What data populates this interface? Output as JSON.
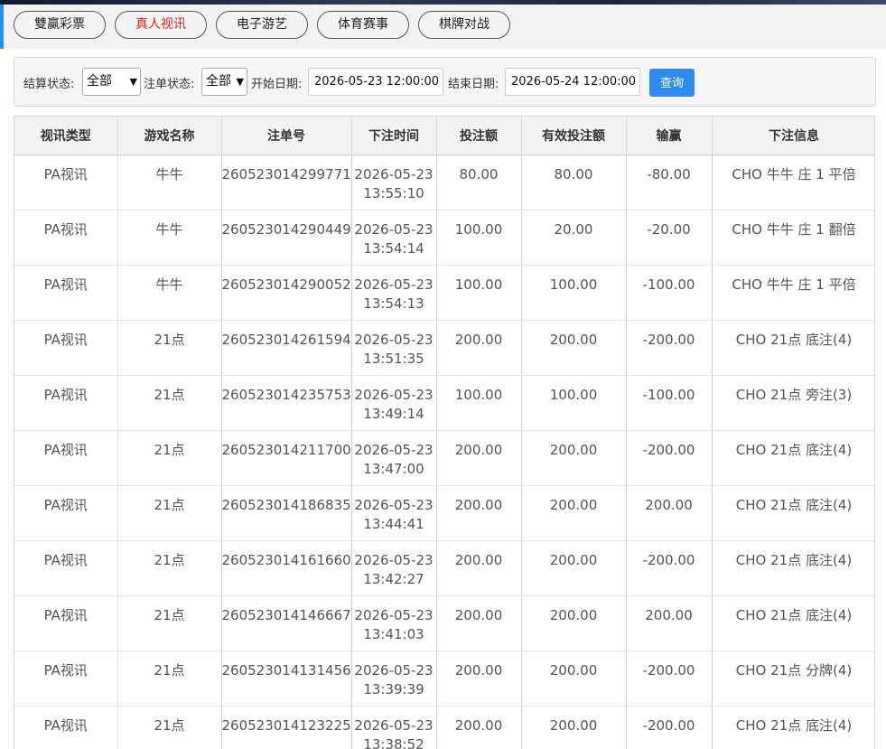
{
  "tabs": [
    {
      "label": "雙贏彩票",
      "active": false
    },
    {
      "label": "真人视讯",
      "active": true
    },
    {
      "label": "电子游艺",
      "active": false
    },
    {
      "label": "体育赛事",
      "active": false
    },
    {
      "label": "棋牌对战",
      "active": false
    }
  ],
  "filters": {
    "settle_label": "结算状态:",
    "settle_value": "全部",
    "order_label": "注单状态:",
    "order_value": "全部",
    "start_label": "开始日期:",
    "start_value": "2026-05-23 12:00:00",
    "end_label": "结束日期:",
    "end_value": "2026-05-24 12:00:00",
    "query_label": "查询"
  },
  "table": {
    "headers": [
      "视讯类型",
      "游戏名称",
      "注单号",
      "下注时间",
      "投注额",
      "有效投注额",
      "输赢",
      "下注信息"
    ],
    "rows": [
      {
        "type": "PA视讯",
        "game": "牛牛",
        "id": "260523014299771",
        "date": "2026-05-23",
        "time": "13:55:10",
        "bet": "80.00",
        "valid": "80.00",
        "result": "-80.00",
        "info": "CHO 牛牛 庄 1 平倍"
      },
      {
        "type": "PA视讯",
        "game": "牛牛",
        "id": "260523014290449",
        "date": "2026-05-23",
        "time": "13:54:14",
        "bet": "100.00",
        "valid": "20.00",
        "result": "-20.00",
        "info": "CHO 牛牛 庄 1 翻倍"
      },
      {
        "type": "PA视讯",
        "game": "牛牛",
        "id": "260523014290052",
        "date": "2026-05-23",
        "time": "13:54:13",
        "bet": "100.00",
        "valid": "100.00",
        "result": "-100.00",
        "info": "CHO 牛牛 庄 1 平倍"
      },
      {
        "type": "PA视讯",
        "game": "21点",
        "id": "260523014261594",
        "date": "2026-05-23",
        "time": "13:51:35",
        "bet": "200.00",
        "valid": "200.00",
        "result": "-200.00",
        "info": "CHO 21点 底注(4)"
      },
      {
        "type": "PA视讯",
        "game": "21点",
        "id": "260523014235753",
        "date": "2026-05-23",
        "time": "13:49:14",
        "bet": "100.00",
        "valid": "100.00",
        "result": "-100.00",
        "info": "CHO 21点 旁注(3)"
      },
      {
        "type": "PA视讯",
        "game": "21点",
        "id": "260523014211700",
        "date": "2026-05-23",
        "time": "13:47:00",
        "bet": "200.00",
        "valid": "200.00",
        "result": "-200.00",
        "info": "CHO 21点 底注(4)"
      },
      {
        "type": "PA视讯",
        "game": "21点",
        "id": "260523014186835",
        "date": "2026-05-23",
        "time": "13:44:41",
        "bet": "200.00",
        "valid": "200.00",
        "result": "200.00",
        "info": "CHO 21点 底注(4)"
      },
      {
        "type": "PA视讯",
        "game": "21点",
        "id": "260523014161660",
        "date": "2026-05-23",
        "time": "13:42:27",
        "bet": "200.00",
        "valid": "200.00",
        "result": "-200.00",
        "info": "CHO 21点 底注(4)"
      },
      {
        "type": "PA视讯",
        "game": "21点",
        "id": "260523014146667",
        "date": "2026-05-23",
        "time": "13:41:03",
        "bet": "200.00",
        "valid": "200.00",
        "result": "200.00",
        "info": "CHO 21点 底注(4)"
      },
      {
        "type": "PA视讯",
        "game": "21点",
        "id": "260523014131456",
        "date": "2026-05-23",
        "time": "13:39:39",
        "bet": "200.00",
        "valid": "200.00",
        "result": "-200.00",
        "info": "CHO 21点 分牌(4)"
      },
      {
        "type": "PA视讯",
        "game": "21点",
        "id": "260523014123225",
        "date": "2026-05-23",
        "time": "13:38:52",
        "bet": "200.00",
        "valid": "200.00",
        "result": "-200.00",
        "info": "CHO 21点 底注(4)"
      }
    ]
  },
  "colors": {
    "accent": "#2d8cf0",
    "active_tab": "#e0201f"
  }
}
